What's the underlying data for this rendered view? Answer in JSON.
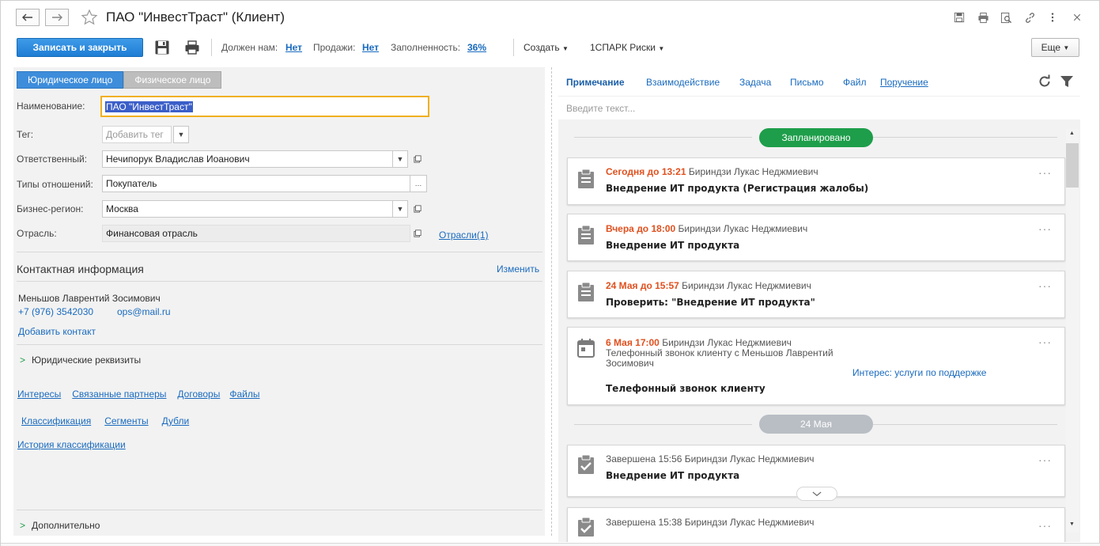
{
  "window": {
    "title": "ПАО \"ИнвестТраст\" (Клиент)"
  },
  "toolbar": {
    "save_close_label": "Записать и закрыть",
    "owes_label": "Должен нам:",
    "owes_value": "Нет",
    "sales_label": "Продажи:",
    "sales_value": "Нет",
    "fill_label": "Заполненность:",
    "fill_value": "36%",
    "create_menu": "Создать",
    "spark_menu": "1СПАРК Риски",
    "more_label": "Еще"
  },
  "left": {
    "tabs": [
      "Юридическое лицо",
      "Физическое лицо"
    ],
    "fields": {
      "name_label": "Наименование:",
      "name_value": "ПАО \"ИнвестТраст\"",
      "tag_label": "Тег:",
      "tag_placeholder": "Добавить тег",
      "responsible_label": "Ответственный:",
      "responsible_value": "Нечипорук Владислав Иоанович",
      "relation_label": "Типы отношений:",
      "relation_value": "Покупатель",
      "region_label": "Бизнес-регион:",
      "region_value": "Москва",
      "industry_label": "Отрасль:",
      "industry_value": "Финансовая отрасль",
      "industry_link": "Отрасли(1)"
    },
    "contact": {
      "header": "Контактная информация",
      "edit_link": "Изменить",
      "person": "Меньшов Лаврентий Зосимович",
      "phone": "+7 (976) 3542030",
      "email": "ops@mail.ru",
      "add_contact": "Добавить контакт"
    },
    "legal_details": "Юридические реквизиты",
    "links_row1": [
      "Интересы",
      "Связанные партнеры",
      "Договоры",
      "Файлы"
    ],
    "links_row2": [
      "Классификация",
      "Сегменты",
      "Дубли"
    ],
    "links_row3": [
      "История классификации"
    ],
    "additional": "Дополнительно"
  },
  "right": {
    "tabs": [
      "Примечание",
      "Взаимодействие",
      "Задача",
      "Письмо",
      "Файл",
      "Поручение"
    ],
    "note_placeholder": "Введите текст...",
    "group_planned": "Запланировано",
    "group_date": "24 Мая",
    "cards": [
      {
        "due": "Сегодня до 13:21",
        "person": "Бириндзи Лукас Неджмиевич",
        "title": "Внедрение ИТ продукта (Регистрация жалобы)",
        "icon": "clipboard-icon"
      },
      {
        "due": "Вчера до 18:00",
        "person": "Бириндзи Лукас Неджмиевич",
        "title": "Внедрение ИТ продукта",
        "icon": "clipboard-icon"
      },
      {
        "due": "24 Мая до 15:57",
        "person": "Бириндзи Лукас Неджмиевич",
        "title": "Проверить: \"Внедрение ИТ продукта\"",
        "icon": "clipboard-icon"
      },
      {
        "due": "6 Мая 17:00",
        "person": "Бириндзи Лукас Неджмиевич",
        "subtitle1": "Телефонный звонок клиенту с Меньшов Лаврентий",
        "subtitle2": "Зосимович",
        "interest": "Интерес: услуги по поддержке",
        "title": "Телефонный звонок клиенту",
        "icon": "calendar-icon"
      },
      {
        "status": "Завершена 15:56 Бириндзи Лукас Неджмиевич",
        "title": "Внедрение ИТ продукта",
        "icon": "clipboard-check-icon"
      },
      {
        "status": "Завершена 15:38 Бириндзи Лукас Неджмиевич",
        "icon": "clipboard-check-icon"
      }
    ]
  },
  "colors": {
    "accent": "#1e7dd4",
    "link": "#1a6bbf",
    "planned_pill": "#1e9e4a",
    "date_pill": "#b9bec4",
    "due": "#e0501e",
    "selection": "#3b5fc9",
    "focus_border": "#f0b020"
  }
}
